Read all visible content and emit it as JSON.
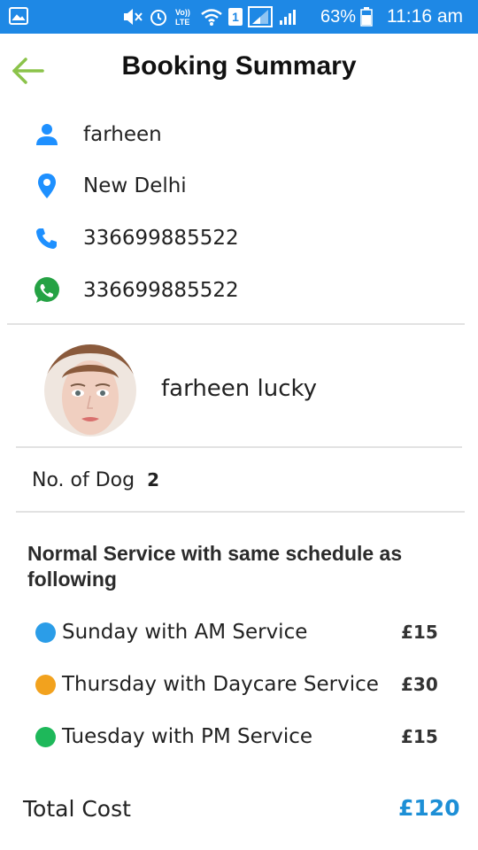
{
  "status_bar": {
    "battery": "63%",
    "time": "11:16 am",
    "sim_slot": "1"
  },
  "header": {
    "title": "Booking Summary"
  },
  "customer": {
    "name": "farheen",
    "location": "New Delhi",
    "phone": "336699885522",
    "whatsapp": "336699885522"
  },
  "provider": {
    "name": "farheen lucky"
  },
  "dogs": {
    "label": "No. of Dog",
    "count": "2"
  },
  "schedule": {
    "heading": "Normal Service with same schedule as following",
    "items": [
      {
        "label": "Sunday with AM Service",
        "price": "£15",
        "color": "#2b9de8"
      },
      {
        "label": "Thursday with Daycare Service",
        "price": "£30",
        "color": "#f2a21e"
      },
      {
        "label": "Tuesday with PM Service",
        "price": "£15",
        "color": "#1eb85a"
      }
    ]
  },
  "total": {
    "label": "Total Cost",
    "value": "£120"
  },
  "colors": {
    "status_bar": "#1e88e5",
    "back_arrow": "#8bc34a",
    "icon_blue": "#1e90ff",
    "whatsapp_green": "#25a244",
    "total_blue": "#1d8fd6"
  }
}
